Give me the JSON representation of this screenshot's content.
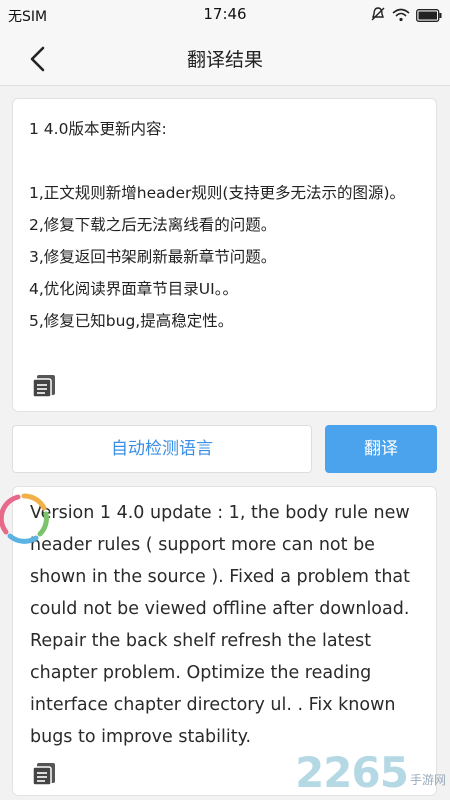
{
  "status_bar": {
    "carrier": "无SIM",
    "time": "17:46"
  },
  "header": {
    "title": "翻译结果"
  },
  "source": {
    "text": "1 4.0版本更新内容:\n\n1,正文规则新增header规则(支持更多无法示的图源)。\n2,修复下载之后无法离线看的问题。\n3,修复返回书架刷新最新章节问题。\n4,优化阅读界面章节目录UI。。\n5,修复已知bug,提高稳定性。"
  },
  "buttons": {
    "detect_language": "自动检测语言",
    "translate": "翻译"
  },
  "result": {
    "text": "Version 1 4.0 update : 1, the body rule new header rules ( support more can not be shown in the source ). Fixed a problem that could not be viewed offline after download. Repair the back shelf refresh the latest chapter problem. Optimize the reading interface chapter directory ul. . Fix known bugs to improve stability."
  },
  "watermark": {
    "number": "2265",
    "suffix": "手游网"
  },
  "colors": {
    "accent": "#4aa3ec",
    "link": "#3a8ee6"
  }
}
